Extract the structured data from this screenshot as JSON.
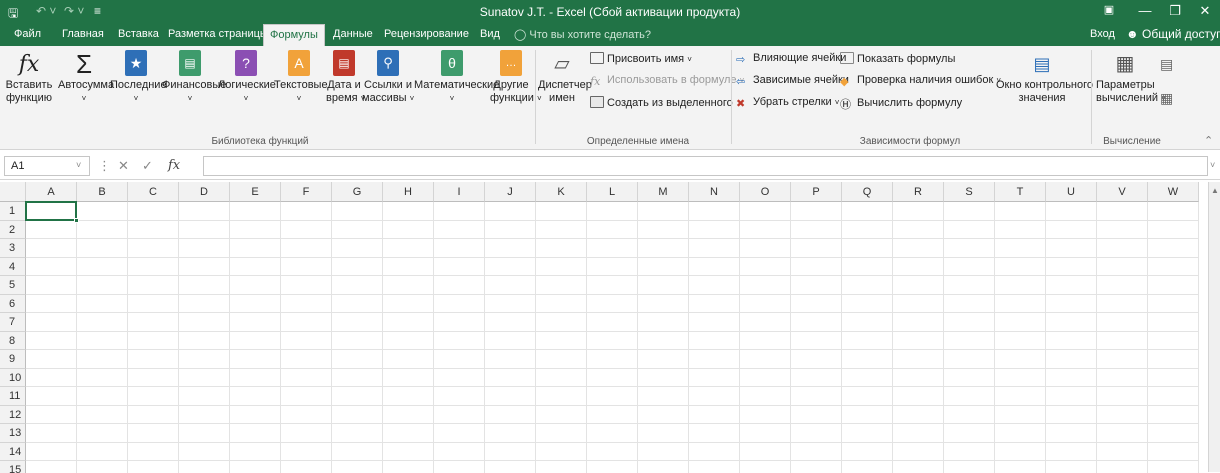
{
  "title": "Sunatov J.T. - Excel (Сбой активации продукта)",
  "tabs": [
    {
      "label": "Файл"
    },
    {
      "label": "Главная"
    },
    {
      "label": "Вставка"
    },
    {
      "label": "Разметка страницы"
    },
    {
      "label": "Формулы"
    },
    {
      "label": "Данные"
    },
    {
      "label": "Рецензирование"
    },
    {
      "label": "Вид"
    }
  ],
  "tell_me": "Что вы хотите сделать?",
  "account": {
    "signin": "Вход",
    "share": "Общий доступ"
  },
  "ribbon": {
    "function_library": {
      "label": "Библиотека функций",
      "insert": [
        "Вставить",
        "функцию"
      ],
      "autosum": "Автосумма",
      "recent": "Последние",
      "financial": "Финансовые",
      "logical": "Логические",
      "text": "Текстовые",
      "datetime": [
        "Дата и",
        "время"
      ],
      "lookup": [
        "Ссылки и",
        "массивы"
      ],
      "math": "Математические",
      "more": [
        "Другие",
        "функции"
      ]
    },
    "defined_names": {
      "label": "Определенные имена",
      "manager": [
        "Диспетчер",
        "имен"
      ],
      "define": "Присвоить имя",
      "use": "Использовать в формуле",
      "create": "Создать из выделенного"
    },
    "auditing": {
      "label": "Зависимости формул",
      "precedents": "Влияющие ячейки",
      "dependents": "Зависимые ячейки",
      "remove": "Убрать стрелки",
      "show": "Показать формулы",
      "error": "Проверка наличия ошибок",
      "evaluate": "Вычислить формулу",
      "watch": [
        "Окно контрольного",
        "значения"
      ]
    },
    "calculation": {
      "label": "Вычисление",
      "options": [
        "Параметры",
        "вычислений"
      ]
    }
  },
  "formula_bar": {
    "cell": "A1",
    "fx": "fx",
    "value": ""
  },
  "columns": [
    "A",
    "B",
    "C",
    "D",
    "E",
    "F",
    "G",
    "H",
    "I",
    "J",
    "K",
    "L",
    "M",
    "N",
    "O",
    "P",
    "Q",
    "R",
    "S",
    "T",
    "U",
    "V",
    "W"
  ],
  "rows": [
    "1",
    "2",
    "3",
    "4",
    "5",
    "6",
    "7",
    "8",
    "9",
    "10",
    "11",
    "12",
    "13",
    "14",
    "15"
  ],
  "accent": "#217346"
}
